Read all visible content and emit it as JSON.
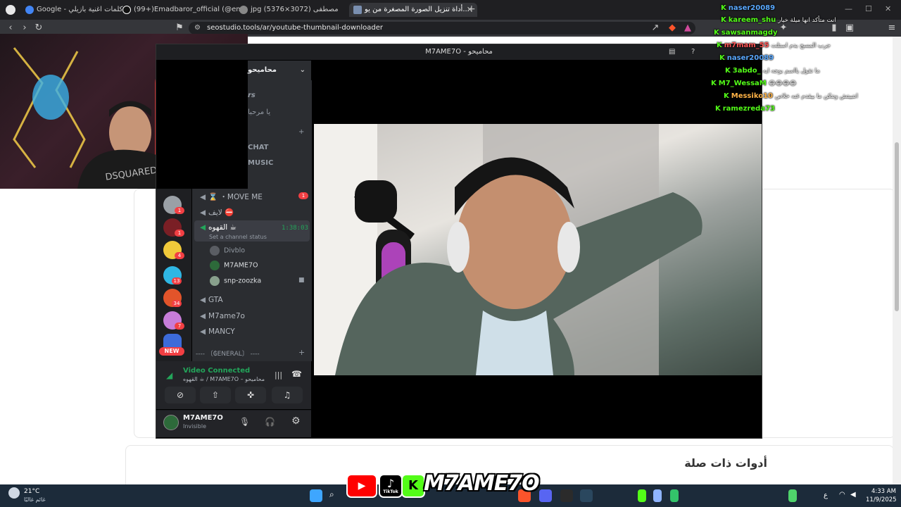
{
  "browser": {
    "tabs": [
      {
        "label": "Google - بحث كلمات اغنية بازيلي"
      },
      {
        "label": "(99+)Emadbaror_official (@emadb3..."
      },
      {
        "label": "jpg (5376×3072) مصطفى"
      },
      {
        "label": "أداة تنزيل الصورة المصغرة من يو..."
      }
    ],
    "new_tab": "+",
    "url": "seostudio.tools/ar/youtube-thumbnail-downloader"
  },
  "page": {
    "related_tools": "أدوات ذات صلة"
  },
  "discord": {
    "window_title": "M7AME7O - محاميحو",
    "server_name": "محاميحو",
    "partial_text": [
      "rs",
      "يا مرحبا",
      "CHAT",
      "MUSIC"
    ],
    "channels": [
      {
        "name": "⌛ ・MOVE ME",
        "badge": "1"
      },
      {
        "name": "لايف ⛔"
      },
      {
        "name": "القهوه ☕",
        "timer": "1:38:03",
        "status": "Set a channel status"
      },
      {
        "name": "GTA"
      },
      {
        "name": "M7ame7o"
      },
      {
        "name": "MANCY"
      },
      {
        "name": "---- 〔₲ENERAL〕 ----"
      }
    ],
    "voice_users": [
      "Divblo",
      "M7AME7O",
      "snp-zoozka"
    ],
    "server_badges": [
      "1",
      "1",
      "4",
      "13",
      "34",
      "7"
    ],
    "new_label": "NEW",
    "voice_status": "Video Connected",
    "voice_channel": "القهوه ☕ / M7AME7O – محاميحو",
    "user": {
      "name": "M7AME7O",
      "status": "Invisible"
    }
  },
  "chat": [
    {
      "user": "naser20089",
      "color": "#5aa9ff",
      "msg": ""
    },
    {
      "user": "kareem_shu",
      "color": "#53fc18",
      "msg": "انت متأكد انها ميلة خيار"
    },
    {
      "user": "sawsanmagdy",
      "color": "#53fc18",
      "msg": ""
    },
    {
      "user": "m7mam_55",
      "color": "#ff5555",
      "msg": "جرب المسح بدم استلت"
    },
    {
      "user": "naser20089",
      "color": "#5aa9ff",
      "msg": ""
    },
    {
      "user": "3abdo_",
      "color": "#53fc18",
      "msg": "ما تقول يااسم بوجه ايه"
    },
    {
      "user": "M7_WessaM",
      "color": "#53fc18",
      "msg": "😂😂😂😂"
    },
    {
      "user": "Messiko10",
      "color": "#ffb347",
      "msg": "انتبيتش ونتكن ما بيقدم غنه خلاص"
    },
    {
      "user": "ramezreda73",
      "color": "#53fc18",
      "msg": ""
    }
  ],
  "branding": {
    "name": "M7AME7O",
    "k_letter": "K",
    "tiktok_label": "TikTok"
  },
  "taskbar": {
    "weather_temp": "21°C",
    "weather_text": "غائم غالبًا",
    "time": "4:33 AM",
    "date": "11/9/2025",
    "lang": "ع"
  }
}
